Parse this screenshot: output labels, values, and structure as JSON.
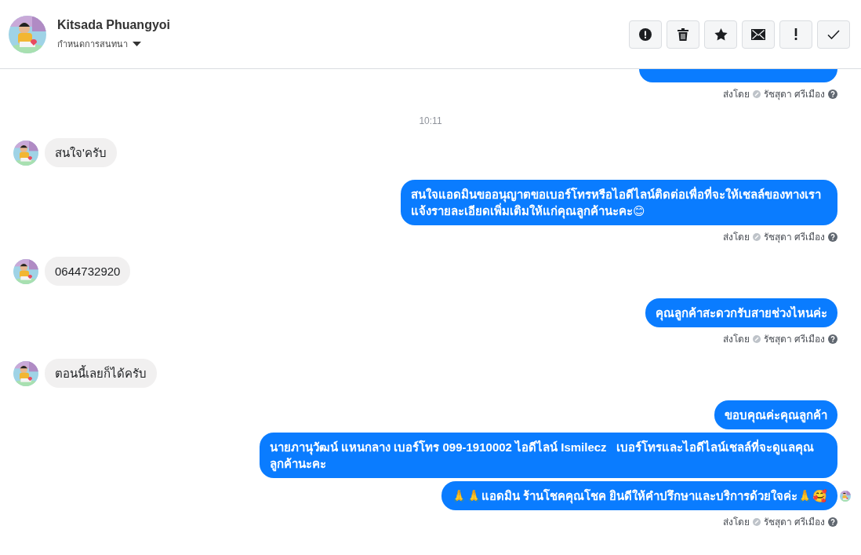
{
  "header": {
    "name": "Kitsada Phuangyoi",
    "subtitle": "กำหนดการสนทนา"
  },
  "toolbar": [
    {
      "kind": "alert"
    },
    {
      "kind": "trash"
    },
    {
      "kind": "star"
    },
    {
      "kind": "mail"
    },
    {
      "kind": "exclaim"
    },
    {
      "kind": "check"
    }
  ],
  "messages": [
    {
      "kind": "clipped"
    },
    {
      "kind": "sent_by",
      "label": "ส่งโดย",
      "sender": "รัชสุดา ศรีเมือง"
    },
    {
      "kind": "time",
      "text": "10:11"
    },
    {
      "kind": "incoming",
      "texts": [
        "สนใจ'ครับ"
      ]
    },
    {
      "kind": "outgoing",
      "texts": [
        "สนใจแอดมินขออนุญาตขอเบอร์โทรหรือไอดีไลน์ติดต่อเพื่อที่จะให้เชลล์ของทางเราแจ้งรายละเอียดเพิ่มเติมให้แก่คุณลูกค้านะคะ😊"
      ],
      "seen": false
    },
    {
      "kind": "sent_by",
      "label": "ส่งโดย",
      "sender": "รัชสุดา ศรีเมือง"
    },
    {
      "kind": "incoming",
      "texts": [
        "0644732920"
      ]
    },
    {
      "kind": "outgoing",
      "texts": [
        "คุณลูกค้าสะดวกรับสายช่วงไหนค่ะ"
      ],
      "seen": false
    },
    {
      "kind": "sent_by",
      "label": "ส่งโดย",
      "sender": "รัชสุดา ศรีเมือง"
    },
    {
      "kind": "incoming",
      "texts": [
        "ตอนนี้เลยก็ได้ครับ"
      ]
    },
    {
      "kind": "outgoing",
      "texts": [
        "ขอบคุณค่ะคุณลูกค้า",
        "นายภานุวัฒน์ แหนกลาง เบอร์โทร 099-1910002 ไอดีไลน์ Ismilecz   เบอร์โทรและไอดีไลน์เชลล์ที่จะดูแลคุณลูกค้านะคะ",
        "🙏🙏แอดมิน ร้านโชคคุณโชค ยินดีให้คำปรึกษาและบริการด้วยใจค่ะ🙏🥰"
      ],
      "seen": true
    },
    {
      "kind": "sent_by",
      "label": "ส่งโดย",
      "sender": "รัชสุดา ศรีเมือง"
    }
  ]
}
